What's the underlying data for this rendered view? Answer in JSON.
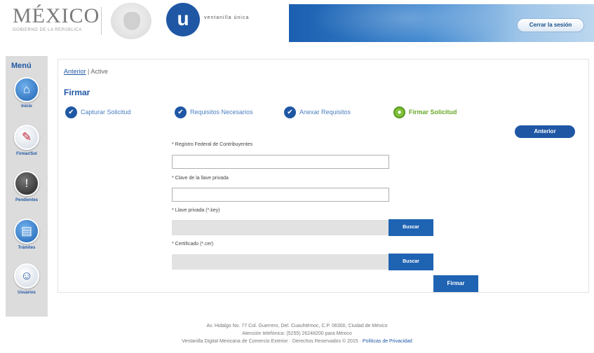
{
  "header": {
    "mexico_word": "MÉXICO",
    "mexico_sub": "GOBIERNO DE LA REPÚBLICA",
    "vu_letter": "u",
    "vu_text": "ventanilla única",
    "logout_label": "Cerrar la sesión"
  },
  "sidebar": {
    "title": "Menú",
    "items": [
      {
        "label": "Inicio",
        "icon": "home-icon",
        "glyph": "⌂"
      },
      {
        "label": "Firmar/Sol",
        "icon": "tools-icon",
        "glyph": "✎"
      },
      {
        "label": "Pendientes",
        "icon": "alert-icon",
        "glyph": "!"
      },
      {
        "label": "Trámites",
        "icon": "document-icon",
        "glyph": "▤"
      },
      {
        "label": "Usuarios",
        "icon": "users-icon",
        "glyph": "☺"
      }
    ]
  },
  "main": {
    "breadcrumb_link": "Anterior",
    "breadcrumb_sep": " | ",
    "breadcrumb_current": "Active",
    "page_title": "Firmar",
    "steps": [
      {
        "label": "Capturar Solicitud",
        "state": "done"
      },
      {
        "label": "Requisitos Necesarios",
        "state": "done"
      },
      {
        "label": "Anexar Requisitos",
        "state": "done"
      },
      {
        "label": "Firmar Solicitud",
        "state": "active"
      }
    ],
    "back_button": "Anterior",
    "fields": {
      "rfc_label": "* Registro Federal de Contribuyentes",
      "rfc_value": "",
      "password_label": "* Clave de la llave privada",
      "password_value": "",
      "key_label": "* Llave privada (*.key)",
      "cert_label": "* Certificado (*.cer)",
      "browse_label": "Buscar"
    },
    "sign_button": "Firmar"
  },
  "footer": {
    "line1": "Av. Hidalgo No. 77 Col. Guerrero, Del. Cuauhtémoc, C.P. 06300, Ciudad de México",
    "line2": "Atención telefónica: (5255) 26248200 para México",
    "line3": "Ventanilla Digital Mexicana de Comercio Exterior · Derechos Reservados © 2015 · ",
    "privacy_link": "Políticas de Privacidad"
  },
  "colors": {
    "primary": "#1f57a5",
    "active_step": "#6aa92a",
    "sidebar_bg": "#dcdcdc"
  }
}
